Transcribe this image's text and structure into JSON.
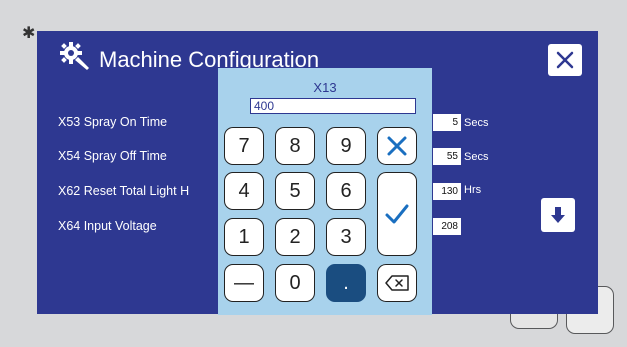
{
  "dialog": {
    "title": "Machine Configuration",
    "close_icon": "close-icon",
    "down_icon": "arrow-down-icon",
    "settings": [
      {
        "label": "X53 Spray On Time",
        "value": "5",
        "unit": "Secs"
      },
      {
        "label": "X54 Spray Off Time",
        "value": "55",
        "unit": "Secs"
      },
      {
        "label": "X62 Reset Total Light H",
        "value": "130",
        "unit": "Hrs"
      },
      {
        "label": "X64 Input Voltage",
        "value": "208",
        "unit": ""
      }
    ]
  },
  "keypad": {
    "title": "X13",
    "input_value": "400",
    "keys": {
      "seven": "7",
      "eight": "8",
      "nine": "9",
      "four": "4",
      "five": "5",
      "six": "6",
      "one": "1",
      "two": "2",
      "three": "3",
      "minus": "—",
      "zero": "0",
      "dot": "."
    },
    "cancel_icon": "close-icon",
    "confirm_icon": "checkmark-icon",
    "backspace_icon": "backspace-icon"
  },
  "colors": {
    "panel": "#2e3891",
    "keypad_bg": "#a8d2ec",
    "accent_blue": "#1a6fc0",
    "dot_key": "#1a4d80"
  }
}
